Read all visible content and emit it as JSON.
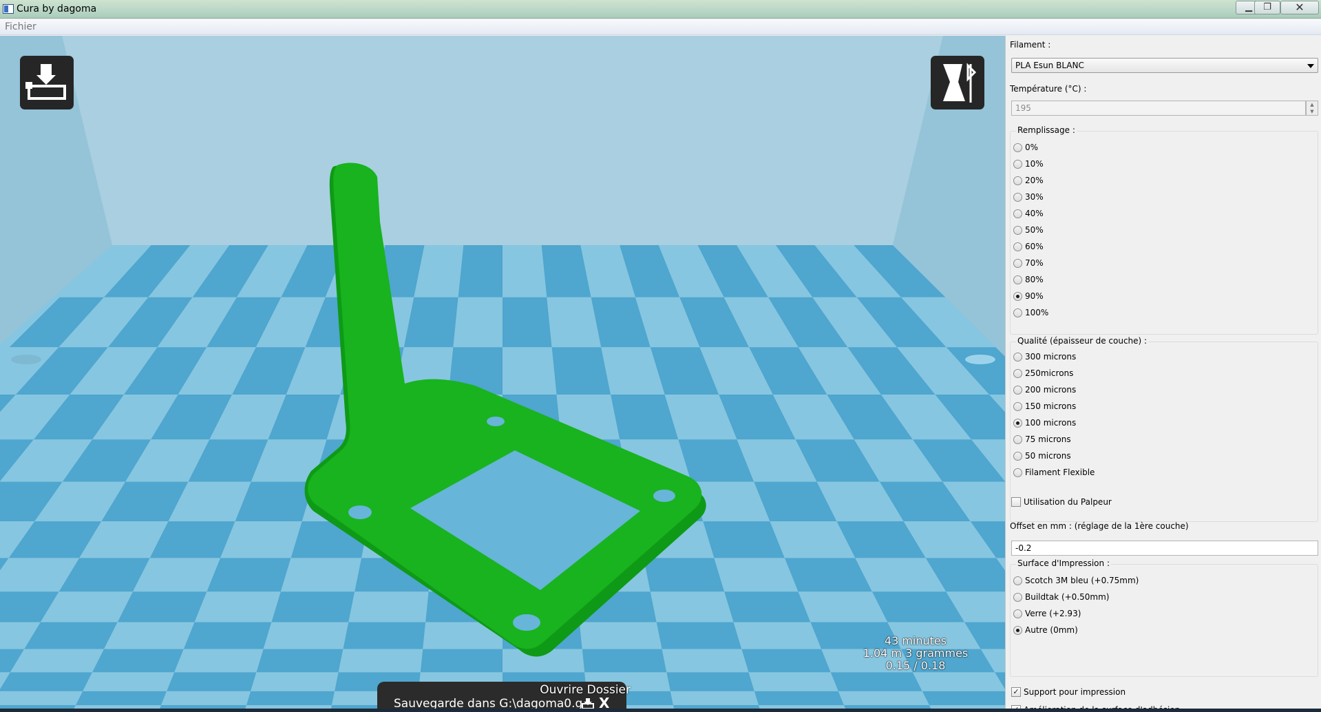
{
  "window": {
    "title": "Cura by dagoma",
    "minimize": "▁",
    "maximize": "❐",
    "close": "✕"
  },
  "menu": {
    "file": "Fichier"
  },
  "viewport": {
    "print_time": "43 minutes",
    "print_material": "1.04 m 3 grammes",
    "print_cost": "0.15 / 0.18",
    "open_folder": "Ouvrire Dossier",
    "save_status": "Sauvegarde dans G:\\dagoma0.g",
    "close_label": "X",
    "model_color": "#14b014",
    "bed_color_light": "#87c6e0",
    "bed_color_dark": "#4fa6cf"
  },
  "panel": {
    "filament_label": "Filament :",
    "filament_value": "PLA Esun BLANC",
    "temperature_label": "Température (°C) :",
    "temperature_value": "195",
    "infill": {
      "title": "Remplissage :",
      "options": [
        "0%",
        "10%",
        "20%",
        "30%",
        "40%",
        "50%",
        "60%",
        "70%",
        "80%",
        "90%",
        "100%"
      ],
      "selected": "90%"
    },
    "quality": {
      "title": "Qualité (épaisseur de couche) :",
      "options": [
        "300 microns",
        "250microns",
        "200 microns",
        "150 microns",
        "100 microns",
        "75 microns",
        "50 microns",
        "Filament Flexible"
      ],
      "selected": "100 microns"
    },
    "probe": {
      "label": "Utilisation du Palpeur",
      "checked": false
    },
    "offset_label": "Offset en mm : (réglage de la 1ère couche)",
    "offset_value": "-0.2",
    "surface": {
      "title": "Surface d'Impression :",
      "options": [
        "Scotch 3M bleu (+0.75mm)",
        "Buildtak (+0.50mm)",
        "Verre (+2.93)",
        "Autre (0mm)"
      ],
      "selected": "Autre (0mm)"
    },
    "support": {
      "label": "Support pour impression",
      "checked": true
    },
    "adhesion": {
      "label": "Amélioration de la surface d'adhésion",
      "checked": true
    }
  }
}
